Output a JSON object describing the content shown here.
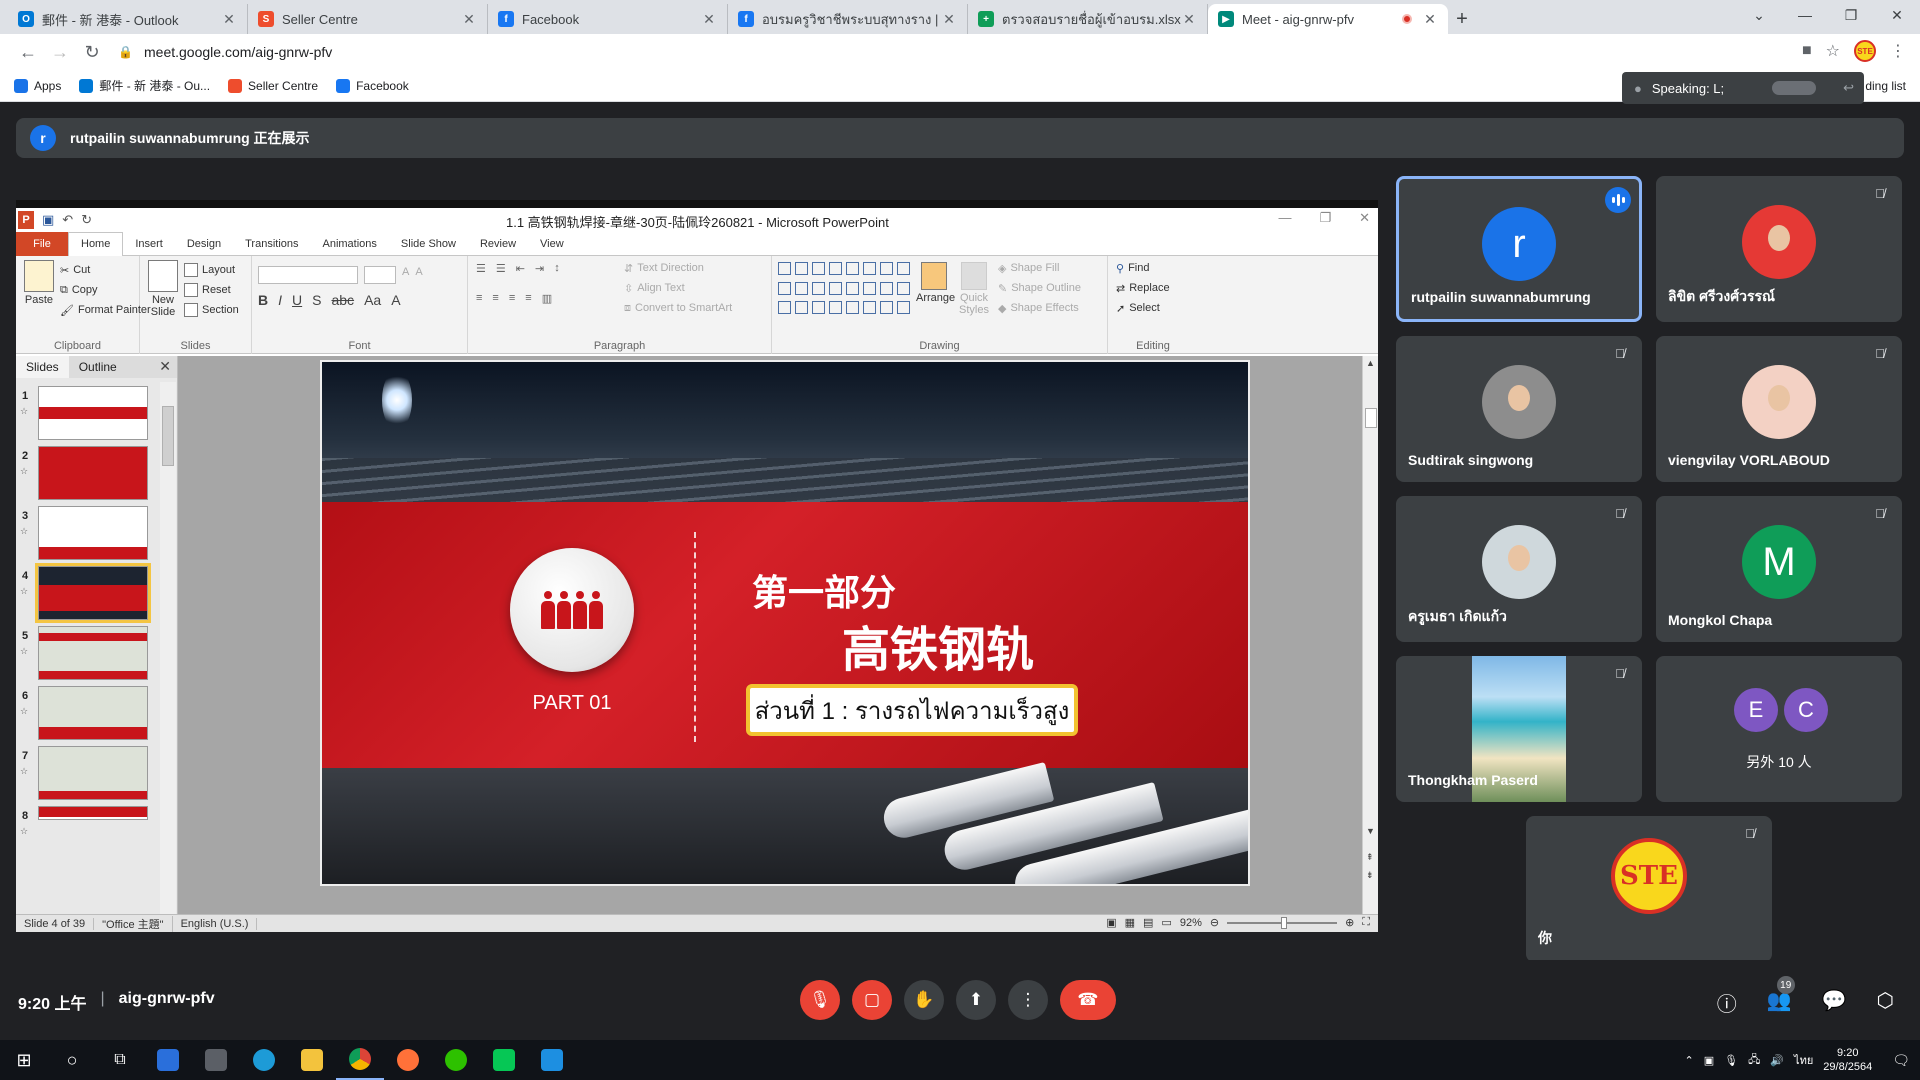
{
  "browser": {
    "tabs": [
      {
        "title": "郵件 - 新 港泰 - Outlook",
        "icon": "outlook-icon",
        "color": "#0078d4"
      },
      {
        "title": "Seller Centre",
        "icon": "shopee-icon",
        "color": "#ee4d2d"
      },
      {
        "title": "Facebook",
        "icon": "facebook-icon",
        "color": "#1877f2"
      },
      {
        "title": "อบรมครูวิชาชีพระบบสุทางราง | Faceb",
        "icon": "facebook-icon",
        "color": "#1877f2"
      },
      {
        "title": "ตรวจสอบรายชื่อผู้เข้าอบรม.xlsx - Goo",
        "icon": "sheets-icon",
        "color": "#0f9d58"
      },
      {
        "title": "Meet - aig-gnrw-pfv",
        "icon": "meet-icon",
        "color": "#00897b"
      }
    ],
    "url": "meet.google.com/aig-gnrw-pfv",
    "bookmarks": [
      {
        "label": "Apps",
        "color": "#1a73e8"
      },
      {
        "label": "郵件 - 新 港泰 - Ou...",
        "color": "#0078d4"
      },
      {
        "label": "Seller Centre",
        "color": "#ee4d2d"
      },
      {
        "label": "Facebook",
        "color": "#1877f2"
      }
    ],
    "reading_list": "ding list",
    "profile_text": "STE"
  },
  "speaking": {
    "label": "Speaking: L;"
  },
  "banner": {
    "avatar_letter": "r",
    "text": "rutpailin suwannabumrung 正在展示"
  },
  "ppt": {
    "title": "1.1 高铁钢轨焊接-章继-30页-陆佩玲260821 - Microsoft PowerPoint",
    "tabs": [
      "File",
      "Home",
      "Insert",
      "Design",
      "Transitions",
      "Animations",
      "Slide Show",
      "Review",
      "View"
    ],
    "clipboard": {
      "paste": "Paste",
      "cut": "Cut",
      "copy": "Copy",
      "format_painter": "Format Painter",
      "label": "Clipboard"
    },
    "slides_grp": {
      "new_slide": "New Slide",
      "layout": "Layout",
      "reset": "Reset",
      "section": "Section",
      "label": "Slides"
    },
    "font_label": "Font",
    "paragraph": {
      "text_direction": "Text Direction",
      "align_text": "Align Text",
      "smartart": "Convert to SmartArt",
      "label": "Paragraph"
    },
    "drawing": {
      "arrange": "Arrange",
      "quick_styles": "Quick Styles",
      "fill": "Shape Fill",
      "outline": "Shape Outline",
      "effects": "Shape Effects",
      "label": "Drawing"
    },
    "editing": {
      "find": "Find",
      "replace": "Replace",
      "select": "Select",
      "label": "Editing"
    },
    "pane_tabs": [
      "Slides",
      "Outline"
    ],
    "thumb_numbers": [
      "1",
      "2",
      "3",
      "4",
      "5",
      "6",
      "7",
      "8"
    ],
    "slide": {
      "section": "第一部分",
      "title": "高铁钢轨",
      "part": "PART 01",
      "thai": "ส่วนที่ 1 :  รางรถไฟความเร็วสูง"
    },
    "status": {
      "slide_of": "Slide 4 of 39",
      "theme": "\"Office 主題\"",
      "lang": "English (U.S.)",
      "zoom": "92%"
    }
  },
  "participants": [
    {
      "name": "rutpailin suwannabumrung",
      "kind": "letter",
      "letter": "r",
      "color": "#1a73e8",
      "speaking": true
    },
    {
      "name": "ลิขิต ศรีวงศ์วรรณ์",
      "kind": "photo",
      "color": "#e53935",
      "speaking": false
    },
    {
      "name": "Sudtirak singwong",
      "kind": "photo",
      "color": "#8d8d8d",
      "speaking": false
    },
    {
      "name": "viengvilay VORLABOUD",
      "kind": "photo",
      "color": "#f3d1c4",
      "speaking": false
    },
    {
      "name": "ครูเมธา เกิดแก้ว",
      "kind": "photo",
      "color": "#cfd8dc",
      "speaking": false
    },
    {
      "name": "Mongkol Chapa",
      "kind": "letter",
      "letter": "M",
      "color": "#0f9d58",
      "speaking": false
    },
    {
      "name": "Thongkham Paserd",
      "kind": "beach",
      "speaking": false
    },
    {
      "name": "另外 10 人",
      "kind": "group",
      "letters": [
        "E",
        "C"
      ],
      "colors": [
        "#7e57c2",
        "#7e57c2"
      ]
    },
    {
      "name": "你",
      "kind": "ste",
      "text": "STE"
    }
  ],
  "meet": {
    "time": "9:20 上午",
    "code": "aig-gnrw-pfv",
    "people_count": "19"
  },
  "taskbar": {
    "time": "9:20",
    "date": "29/8/2564",
    "lang": "ไทย"
  }
}
